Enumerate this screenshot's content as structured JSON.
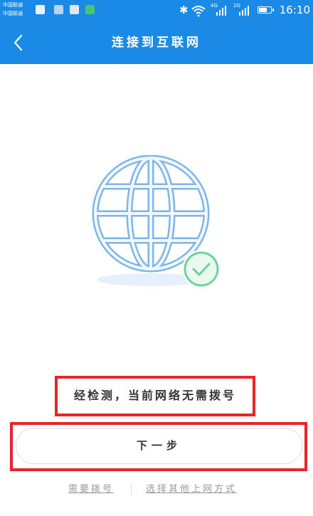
{
  "status_bar": {
    "carrier_1": "中国联通",
    "carrier_2": "中国联通",
    "app_icons": [
      "photo-app-icon",
      "settings-app-icon",
      "gallery-app-icon",
      "message-app-icon"
    ],
    "bluetooth": "✱",
    "wifi": "wifi-icon",
    "sim1_network": "4G",
    "sim2_network": "2G",
    "battery_level": 0.75,
    "time": "16:10"
  },
  "nav": {
    "back_icon": "chevron-left-icon",
    "title": "连接到互联网"
  },
  "illustration": {
    "globe_icon": "globe-icon",
    "check_icon": "check-circle-icon"
  },
  "notice": "经检测，当前网络无需拨号",
  "next_button": "下一步",
  "links": {
    "dial": "需要拨号",
    "other": "选择其他上网方式"
  },
  "colors": {
    "primary": "#1a8ae6",
    "globe_line": "#7fb6ea",
    "check_green": "#6fd39a",
    "highlight_red": "#e8252c"
  }
}
